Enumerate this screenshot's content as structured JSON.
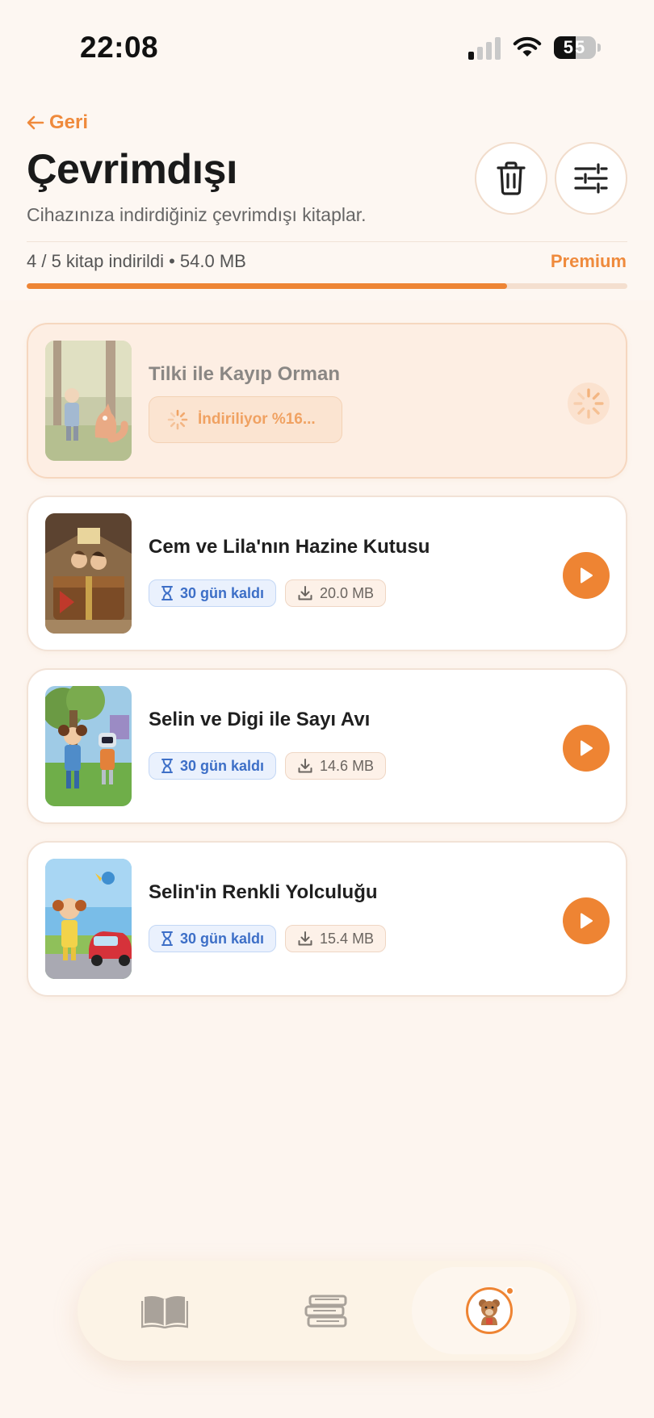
{
  "status_bar": {
    "time": "22:08",
    "battery": "55"
  },
  "header": {
    "back_label": "Geri",
    "title": "Çevrimdışı",
    "subtitle": "Cihazınıza indirdiğiniz çevrimdışı kitaplar.",
    "storage_summary": "4 / 5 kitap indirildi • 54.0 MB",
    "plan_label": "Premium",
    "storage_progress": 0.8
  },
  "books": [
    {
      "title": "Tilki ile Kayıp Orman",
      "status": "downloading",
      "download_label": "İndiriliyor %16..."
    },
    {
      "title": "Cem ve Lila'nın Hazine Kutusu",
      "time_left": "30 gün kaldı",
      "size": "20.0 MB"
    },
    {
      "title": "Selin ve Digi ile Sayı Avı",
      "time_left": "30 gün kaldı",
      "size": "14.6 MB"
    },
    {
      "title": "Selin'in Renkli Yolculuğu",
      "time_left": "30 gün kaldı",
      "size": "15.4 MB"
    }
  ],
  "tabs": [
    {
      "icon": "open-book-icon"
    },
    {
      "icon": "book-stack-icon"
    },
    {
      "icon": "bear-avatar-icon",
      "active": true,
      "notification": true
    }
  ],
  "colors": {
    "accent": "#ee8433",
    "chip_blue": "#3d6fc7",
    "background": "#fdf5ef"
  }
}
